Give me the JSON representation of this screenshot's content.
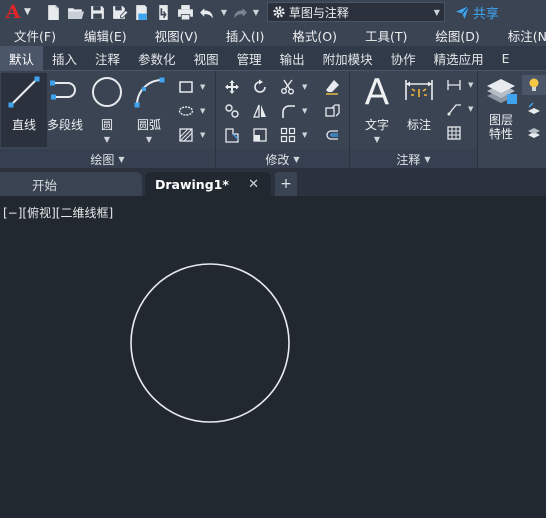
{
  "app": {
    "logo_letter": "A"
  },
  "quick_access": {
    "workspace": "草图与注释",
    "share_label": "共享"
  },
  "menu": [
    "文件(F)",
    "编辑(E)",
    "视图(V)",
    "插入(I)",
    "格式(O)",
    "工具(T)",
    "绘图(D)",
    "标注(N)"
  ],
  "ribbon_tabs": [
    "默认",
    "插入",
    "注释",
    "参数化",
    "视图",
    "管理",
    "输出",
    "附加模块",
    "协作",
    "精选应用",
    "E"
  ],
  "active_ribbon_tab": "默认",
  "draw_panel": {
    "title": "绘图",
    "tools": {
      "line": "直线",
      "polyline": "多段线",
      "circle": "圆",
      "arc": "圆弧"
    }
  },
  "modify_panel": {
    "title": "修改"
  },
  "annotation_panel": {
    "title": "注释",
    "tools": {
      "text": "文字",
      "dimension": "标注"
    }
  },
  "layers_panel": {
    "layer_properties": "图层\n特性",
    "layer_line1": "图层",
    "layer_line2": "特性"
  },
  "doc_tabs": {
    "start": "开始",
    "active": "Drawing1*",
    "close": "✕",
    "add": "+"
  },
  "viewport": {
    "label": "[−][俯视][二维线框]"
  },
  "colors": {
    "background": "#212830",
    "ribbon": "#3b4453",
    "accent": "#3fa4f0",
    "logo": "#e0262b",
    "geometry": "#e9ebee"
  },
  "drawing": {
    "entities": [
      {
        "type": "circle"
      }
    ]
  }
}
